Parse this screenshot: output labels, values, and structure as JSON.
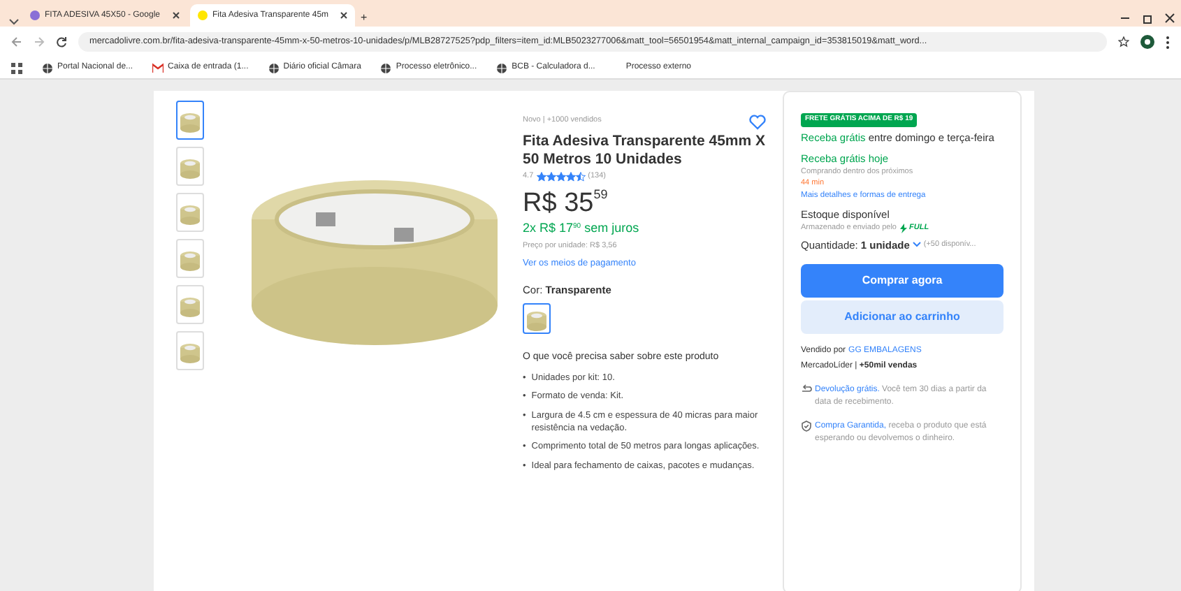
{
  "browser": {
    "tabs": [
      {
        "title": "FITA ADESIVA 45X50 - Google",
        "selected": false
      },
      {
        "title": "Fita Adesiva Transparente 45m",
        "selected": true
      }
    ],
    "new_tab": "+",
    "url": "mercadolivre.com.br/fita-adesiva-transparente-45mm-x-50-metros-10-unidades/p/MLB28727525?pdp_filters=item_id:MLB5023277006&matt_tool=56501954&matt_internal_campaign_id=353815019&matt_word...",
    "bookmarks": [
      {
        "label": "Portal Nacional de...",
        "kind": "globe"
      },
      {
        "label": "Caixa de entrada (1...",
        "kind": "mail"
      },
      {
        "label": "Diário oficial Câmara",
        "kind": "globe"
      },
      {
        "label": "Processo eletrônico...",
        "kind": "globe"
      },
      {
        "label": "BCB - Calculadora d...",
        "kind": "globe"
      },
      {
        "label": "Processo externo",
        "kind": "none"
      }
    ]
  },
  "gallery": {
    "thumbnails": [
      {
        "selected": true
      },
      {
        "selected": false
      },
      {
        "selected": false
      },
      {
        "selected": false
      },
      {
        "selected": false
      },
      {
        "selected": false
      }
    ]
  },
  "product": {
    "condition": "Novo  |  +1000 vendidos",
    "favorited": false,
    "title": "Fita Adesiva Transparente 45mm X 50 Metros 10 Unidades",
    "rating": "4.7",
    "stars": 4.5,
    "reviews": "(134)",
    "price_currency": "R$",
    "price_whole": "35",
    "price_cents": "59",
    "installments": "2x R$ 17$^{90}$ sem juros",
    "unit_price": "Preço por unidade: R$ 3,56",
    "payment_link": "Ver os meios de pagamento",
    "color_label": "Cor:",
    "color_value": "Transparente",
    "color_options": [
      {
        "selected": true
      }
    ],
    "features_title": "O que você precisa saber sobre este produto",
    "bullet": "•",
    "features": [
      "Unidades por kit: 10.",
      "Formato de venda: Kit.",
      "Largura de 4.5 cm e espessura de 40 micras para maior resistência na vedação.",
      "Comprimento total de 50 metros para longas aplicações.",
      "Ideal para fechamento de caixas, pacotes e mudanças."
    ]
  },
  "purchase": {
    "shipping_badge": "FRETE GRÁTIS ACIMA DE R$ 19",
    "delivery": "**Receba grátis** entre domingo e terça-feira",
    "today": "Receba grátis hoje",
    "countdown_text": "Comprando dentro dos próximos",
    "countdown": "44 min",
    "delivery_link": "Mais detalhes e formas de entrega",
    "stock_title": "Estoque disponível",
    "stock_note": "Armazenado e enviado pelo",
    "full": "FULL",
    "quantity_label": "Quantidade:",
    "quantity": "1 unidade",
    "available": "(+50 disponív...",
    "buy_button": "Comprar agora",
    "cart_button": "Adicionar ao carrinho",
    "seller_label": "Vendido por",
    "seller": "GG EMBALAGENS",
    "seller_level": "MercadoLíder  |  **+50mil vendas**",
    "guarantees": [
      {
        "kind": "return",
        "link": "Devolução grátis.",
        "text": " Você tem 30 dias a partir da data de recebimento."
      },
      {
        "kind": "shield",
        "link": "Compra Garantida,",
        "text": " receba o produto que está esperando ou devolvemos o dinheiro."
      }
    ]
  }
}
